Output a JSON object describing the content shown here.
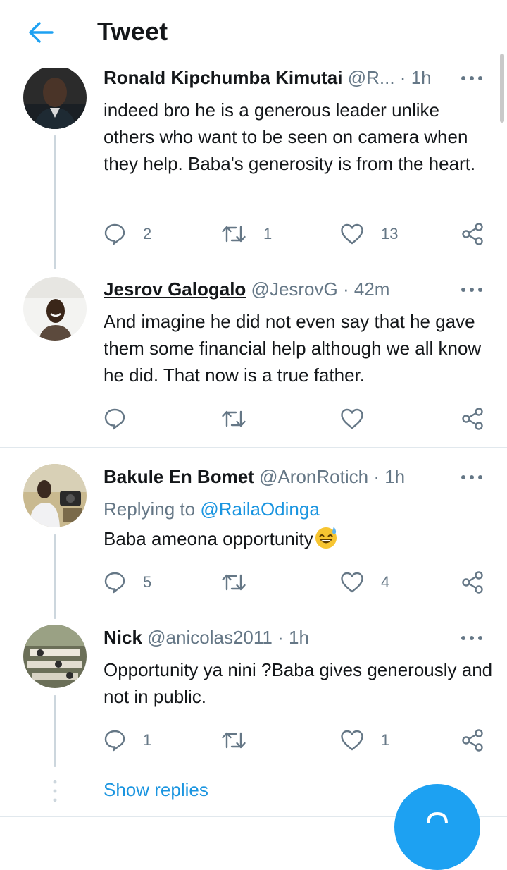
{
  "header": {
    "title": "Tweet",
    "back_icon": "arrow-left-icon"
  },
  "accent_color": "#1da1f2",
  "tweets": [
    {
      "name": "Ronald Kipchumba Kimutai",
      "handle": "@R...",
      "dot": "·",
      "time": "1h",
      "text": "indeed bro he is a generous leader unlike others who want to be seen on camera when they help. Baba's generosity is from the heart.",
      "replies": "2",
      "retweets": "1",
      "likes": "13"
    },
    {
      "name": "Jesrov Galogalo",
      "handle": "@JesrovG",
      "dot": "·",
      "time": "42m",
      "text": "And imagine he did not even say that he gave them some financial help although we all know he did. That now is a true father."
    },
    {
      "name": "Bakule En Bomet",
      "handle": "@AronRotich",
      "dot": "·",
      "time": "1h",
      "replying_prefix": "Replying to",
      "replying_to": "@RailaOdinga",
      "text": "Baba ameona opportunity",
      "emoji": "sweat-smile-emoji",
      "replies": "5",
      "likes": "4"
    },
    {
      "name": "Nick",
      "handle": "@anicolas2011",
      "dot": "·",
      "time": "1h",
      "text": "Opportunity ya nini ?Baba gives generously and not in public.",
      "replies": "1",
      "likes": "1"
    }
  ],
  "show_replies": "Show replies"
}
